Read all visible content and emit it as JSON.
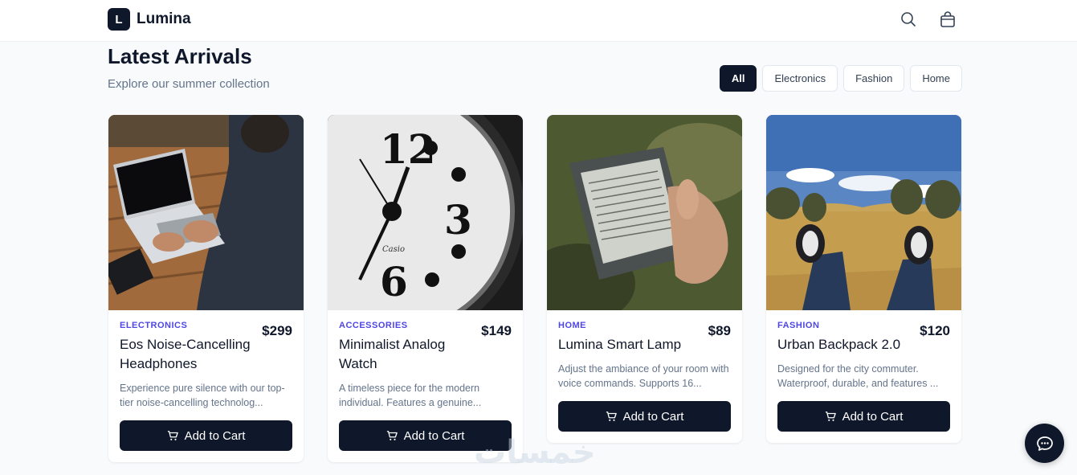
{
  "brand": {
    "mark": "L",
    "name": "Lumina"
  },
  "header_icons": [
    "search-icon",
    "shopping-bag-icon"
  ],
  "page": {
    "title": "Latest Arrivals",
    "subtitle": "Explore our summer collection"
  },
  "filters": [
    {
      "label": "All",
      "active": true
    },
    {
      "label": "Electronics",
      "active": false
    },
    {
      "label": "Fashion",
      "active": false
    },
    {
      "label": "Home",
      "active": false
    }
  ],
  "products": [
    {
      "category": "ELECTRONICS",
      "price": "$299",
      "name": "Eos Noise-Cancelling Headphones",
      "description": "Experience pure silence with our top-tier noise-cancelling technolog...",
      "button": "Add to Cart",
      "image": "person-on-laptop"
    },
    {
      "category": "ACCESSORIES",
      "price": "$149",
      "name": "Minimalist Analog Watch",
      "description": "A timeless piece for the modern individual. Features a genuine...",
      "button": "Add to Cart",
      "image": "clock-face"
    },
    {
      "category": "HOME",
      "price": "$89",
      "name": "Lumina Smart Lamp",
      "description": "Adjust the ambiance of your room with voice commands. Supports 16...",
      "button": "Add to Cart",
      "image": "e-reader-in-hand"
    },
    {
      "category": "FASHION",
      "price": "$120",
      "name": "Urban Backpack 2.0",
      "description": "Designed for the city commuter. Waterproof, durable, and features ...",
      "button": "Add to Cart",
      "image": "sneakers-on-field"
    }
  ],
  "chat": {
    "icon": "chat-bubble-icon"
  },
  "watermark": "خمسات",
  "colors": {
    "primary": "#0f172a",
    "accent": "#4f46e5",
    "muted": "#64748b",
    "background": "#f8fafc"
  }
}
